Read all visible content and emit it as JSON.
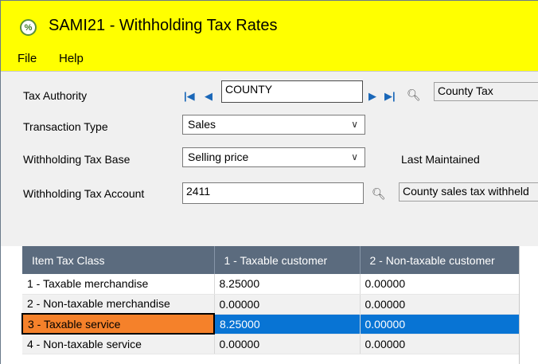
{
  "window": {
    "title": "SAMI21 - Withholding Tax Rates",
    "app_icon_glyph": "%"
  },
  "menu": {
    "items": [
      "File",
      "Help"
    ]
  },
  "form": {
    "tax_authority": {
      "label": "Tax Authority",
      "value": "COUNTY",
      "description": "County Tax"
    },
    "transaction_type": {
      "label": "Transaction Type",
      "value": "Sales"
    },
    "withholding_tax_base": {
      "label": "Withholding Tax Base",
      "value": "Selling price"
    },
    "last_maintained": {
      "label": "Last Maintained"
    },
    "withholding_tax_account": {
      "label": "Withholding Tax Account",
      "value": "2411",
      "description": "County sales tax withheld"
    }
  },
  "grid": {
    "columns": [
      "Item Tax Class",
      "1 - Taxable customer",
      "2 - Non-taxable customer"
    ],
    "rows": [
      [
        "1 - Taxable merchandise",
        "8.25000",
        "0.00000"
      ],
      [
        "2 - Non-taxable merchandise",
        "0.00000",
        "0.00000"
      ],
      [
        "3 - Taxable service",
        "8.25000",
        "0.00000"
      ],
      [
        "4 - Non-taxable service",
        "0.00000",
        "0.00000"
      ]
    ],
    "selected_row": 2
  },
  "colors": {
    "titlebar": "#ffff00",
    "grid_header": "#5b6b7e",
    "selection": "#0874d4",
    "row_highlight": "#f5812a"
  }
}
